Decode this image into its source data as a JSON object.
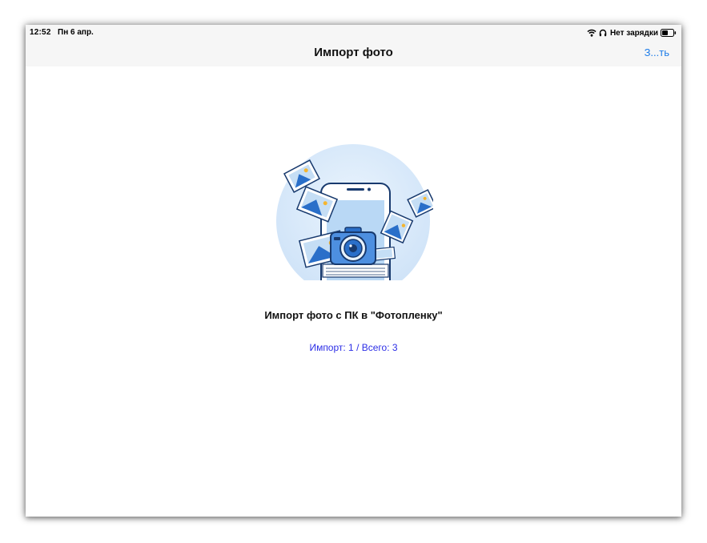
{
  "status_bar": {
    "time": "12:52",
    "date": "Пн 6 апр.",
    "charging": "Нет зарядки",
    "icons": [
      "wifi-icon",
      "headphones-icon",
      "battery-icon"
    ]
  },
  "nav": {
    "title": "Импорт фото",
    "action_label": "З...ть"
  },
  "main": {
    "illustration": "phone-camera-photos-illustration",
    "caption": "Импорт фото с ПК в \"Фотопленку\"",
    "progress_text": "Импорт: 1 / Всего: 3"
  },
  "colors": {
    "accent": "#1d7ce8",
    "progress_text": "#2c2ee6",
    "bar_background": "#f6f6f6"
  }
}
